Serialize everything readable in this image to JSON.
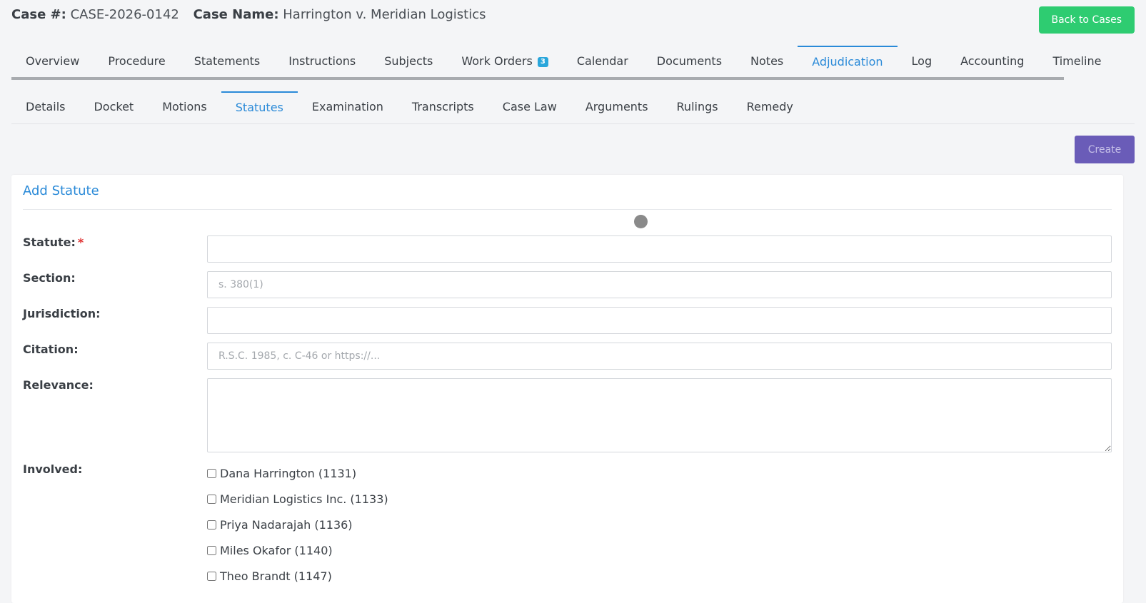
{
  "header": {
    "case_number_label": "Case #:",
    "case_number": "CASE-2026-0142",
    "case_name_label": "Case Name:",
    "case_name": "Harrington v. Meridian Logistics",
    "back_button": "Back to Cases"
  },
  "main_tabs": [
    {
      "label": "Overview"
    },
    {
      "label": "Procedure"
    },
    {
      "label": "Statements"
    },
    {
      "label": "Instructions"
    },
    {
      "label": "Subjects"
    },
    {
      "label": "Work Orders",
      "badge": "3"
    },
    {
      "label": "Calendar"
    },
    {
      "label": "Documents"
    },
    {
      "label": "Notes"
    },
    {
      "label": "Adjudication",
      "active": true
    },
    {
      "label": "Log"
    },
    {
      "label": "Accounting"
    },
    {
      "label": "Timeline"
    }
  ],
  "sub_tabs": [
    {
      "label": "Details"
    },
    {
      "label": "Docket"
    },
    {
      "label": "Motions"
    },
    {
      "label": "Statutes",
      "active": true
    },
    {
      "label": "Examination"
    },
    {
      "label": "Transcripts"
    },
    {
      "label": "Case Law"
    },
    {
      "label": "Arguments"
    },
    {
      "label": "Rulings"
    },
    {
      "label": "Remedy"
    }
  ],
  "toolbar": {
    "create_label": "Create"
  },
  "form": {
    "title": "Add Statute",
    "statute_label": "Statute:",
    "required_mark": "*",
    "statute_value": "",
    "section_label": "Section:",
    "section_placeholder": "s. 380(1)",
    "jurisdiction_label": "Jurisdiction:",
    "jurisdiction_value": "",
    "citation_label": "Citation:",
    "citation_placeholder": "R.S.C. 1985, c. C-46 or https://...",
    "relevance_label": "Relevance:",
    "involved_label": "Involved:",
    "involved": [
      {
        "label": "Dana Harrington (1131)",
        "checked": false
      },
      {
        "label": "Meridian Logistics Inc. (1133)",
        "checked": false
      },
      {
        "label": "Priya Nadarajah (1136)",
        "checked": false
      },
      {
        "label": "Miles Okafor (1140)",
        "checked": false
      },
      {
        "label": "Theo Brandt (1147)",
        "checked": false
      }
    ]
  },
  "colors": {
    "accent": "#2a8ad8",
    "back_button": "#2ecc71",
    "create_button": "#6a5cb8",
    "required": "#e03131",
    "badge": "#29a6db"
  }
}
